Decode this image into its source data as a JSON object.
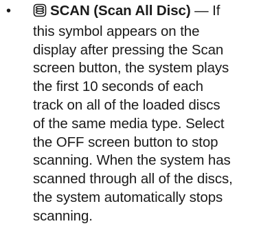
{
  "bullet_symbol": "•",
  "icon": "scan-all-disc-icon",
  "term": "SCAN (Scan All Disc)",
  "separator": " — ",
  "lines": [
    "If",
    "this symbol appears on the",
    "display after pressing the Scan",
    "screen button, the system plays",
    "the first 10 seconds of each",
    "track on all of the loaded discs",
    "of the same media type. Select",
    "the OFF screen button to stop",
    "scanning. When the system has",
    "scanned through all of the discs,",
    "the system automatically stops",
    "scanning."
  ]
}
